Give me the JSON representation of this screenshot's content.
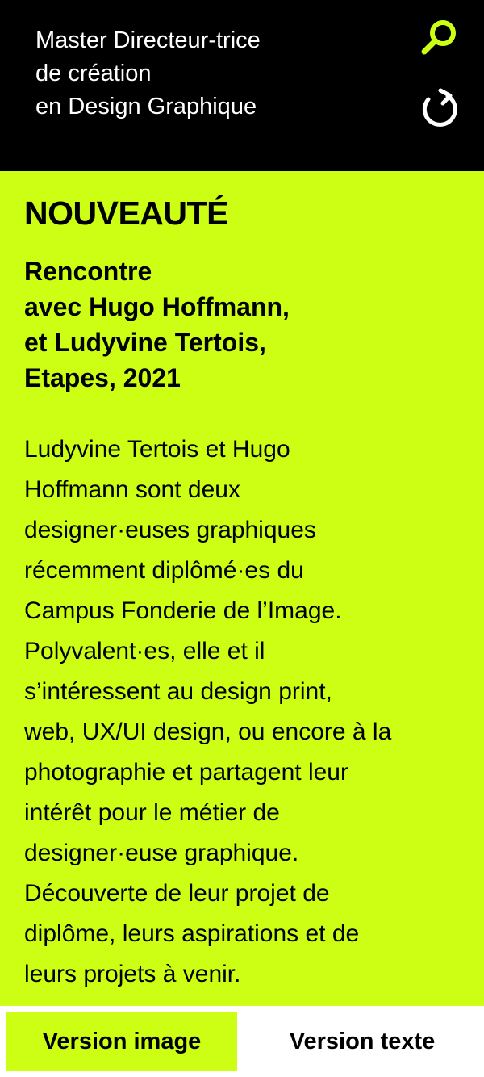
{
  "colors": {
    "accent": "#ccff14",
    "header_bg": "#000000",
    "header_text": "#ffffff",
    "body_text": "#000000"
  },
  "header": {
    "title_lines": [
      "Master Directeur-trice",
      "de création",
      "en Design Graphique"
    ],
    "search_icon": "search-icon",
    "refresh_icon": "refresh-icon"
  },
  "article": {
    "eyebrow": "NOUVEAUTÉ",
    "title_lines": [
      "Rencontre",
      "avec Hugo Hoffmann,",
      "et Ludyvine Tertois,",
      "Etapes, 2021"
    ],
    "body_lines": [
      "Ludyvine Tertois et Hugo",
      "Hoffmann sont deux",
      "designer·euses graphiques",
      "récemment diplômé·es du",
      "Campus Fonderie de l’Image.",
      "Polyvalent·es, elle et il",
      "s’intéressent au design print,",
      "web, UX/UI design, ou encore à la",
      "photographie et partagent leur",
      "intérêt pour le métier de",
      "designer·euse graphique.",
      "Découverte de leur projet de",
      "diplôme, leurs aspirations et de",
      "leurs projets à venir."
    ]
  },
  "tabs": [
    {
      "label": "Version image",
      "active": true
    },
    {
      "label": "Version texte",
      "active": false
    }
  ]
}
